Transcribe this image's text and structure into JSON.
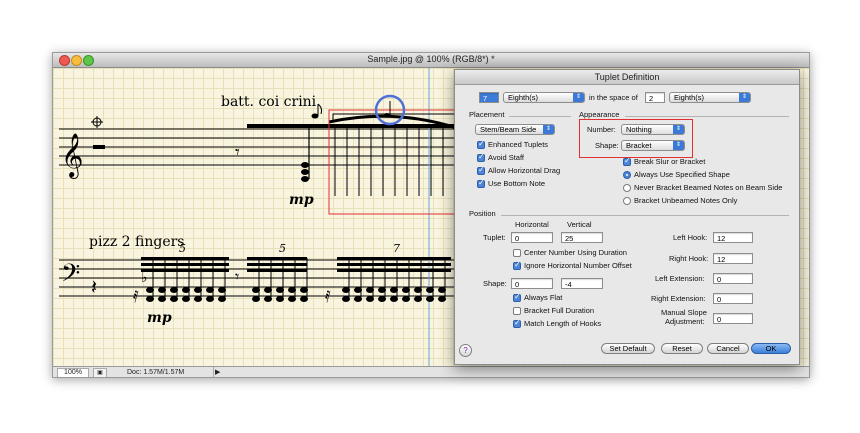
{
  "window": {
    "title": "Sample.jpg @ 100% (RGB/8*) *"
  },
  "status": {
    "zoom": "100%",
    "doc": "Doc: 1.57M/1.57M"
  },
  "score": {
    "text1": "batt. coi crini",
    "text2": "pizz 2 fingers",
    "dyn1": "mp",
    "dyn2": "mp",
    "tup1": "5",
    "tup2": "5",
    "tup3": "7"
  },
  "dialog": {
    "title": "Tuplet Definition",
    "tuplet_count": "7",
    "tuplet_unit": "Eighth(s)",
    "space_label": "in the space of",
    "space_count": "2",
    "space_unit": "Eighth(s)",
    "placement_label": "Placement",
    "placement_value": "Stem/Beam Side",
    "enhanced": "Enhanced Tuplets",
    "avoid_staff": "Avoid Staff",
    "allow_drag": "Allow Horizontal Drag",
    "use_bottom": "Use Bottom Note",
    "appearance_label": "Appearance",
    "number_label": "Number:",
    "number_value": "Nothing",
    "shape_label": "Shape:",
    "shape_value": "Bracket",
    "break_slur": "Break Slur or Bracket",
    "always_use": "Always Use Specified Shape",
    "never_bracket": "Never Bracket Beamed Notes on Beam Side",
    "bracket_unbeamed": "Bracket Unbeamed Notes Only",
    "position_label": "Position",
    "horizontal_label": "Horizontal",
    "vertical_label": "Vertical",
    "tuplet_label": "Tuplet:",
    "tuplet_h": "0",
    "tuplet_v": "25",
    "center_number": "Center Number Using Duration",
    "ignore_offset": "Ignore Horizontal Number Offset",
    "shape_pos_label": "Shape:",
    "shape_h": "0",
    "shape_v": "-4",
    "always_flat": "Always Flat",
    "bracket_full": "Bracket Full Duration",
    "match_length": "Match Length of Hooks",
    "left_hook_label": "Left Hook:",
    "left_hook": "12",
    "right_hook_label": "Right Hook:",
    "right_hook": "12",
    "left_ext_label": "Left Extension:",
    "left_ext": "0",
    "right_ext_label": "Right Extension:",
    "right_ext": "0",
    "manual_slope_label1": "Manual Slope",
    "manual_slope_label2": "Adjustment:",
    "manual_slope": "0",
    "set_default": "Set Default",
    "reset": "Reset",
    "cancel": "Cancel",
    "ok": "OK",
    "help": "?"
  }
}
